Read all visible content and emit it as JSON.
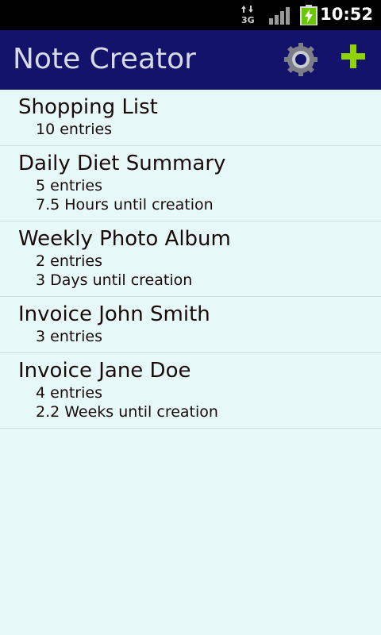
{
  "status_bar": {
    "time": "10:52",
    "network_label": "3G",
    "icons": [
      "data-activity-icon",
      "signal-icon",
      "battery-charging-icon"
    ]
  },
  "action_bar": {
    "title": "Note Creator",
    "settings_icon": "gear-icon",
    "add_icon": "plus-icon",
    "colors": {
      "background": "#13136c",
      "title": "#d6dbe6",
      "add_icon": "#8fd400",
      "settings_icon": "#7c7f88"
    }
  },
  "notes": [
    {
      "title": "Shopping List",
      "lines": [
        "10 entries"
      ]
    },
    {
      "title": "Daily Diet Summary",
      "lines": [
        "5 entries",
        "7.5 Hours until creation"
      ]
    },
    {
      "title": "Weekly Photo Album",
      "lines": [
        "2 entries",
        "3 Days until creation"
      ]
    },
    {
      "title": "Invoice John Smith",
      "lines": [
        "3 entries"
      ]
    },
    {
      "title": "Invoice Jane Doe",
      "lines": [
        "4 entries",
        "2.2 Weeks until creation"
      ]
    }
  ],
  "colors": {
    "list_background": "#e6f8f8",
    "divider": "#cfdede",
    "text": "#1a0a0a"
  }
}
